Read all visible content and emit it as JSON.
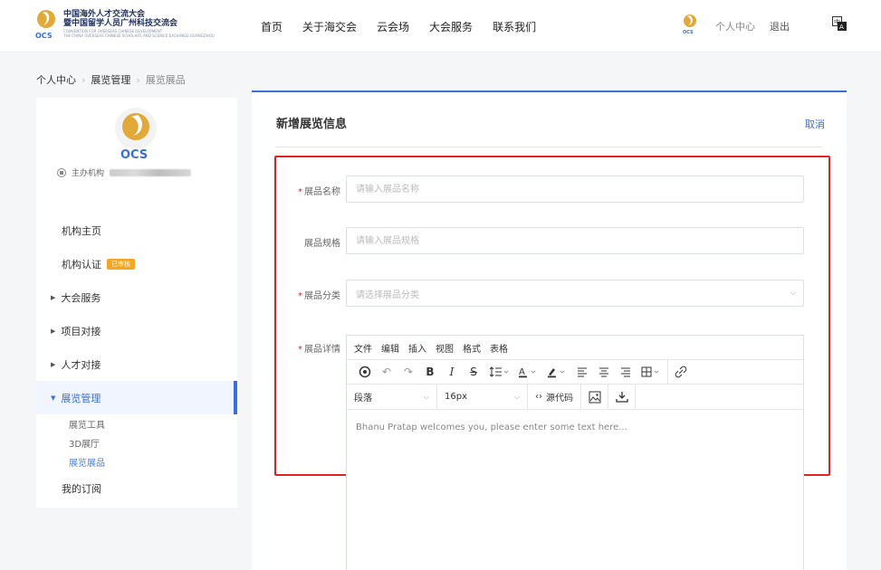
{
  "header": {
    "logo_line1": "中国海外人才交流大会",
    "logo_line2": "暨中国留学人员广州科技交流会",
    "logo_line3": "CONVENTION FOR OVERSEAS CHINESE DEVELOPMENT",
    "logo_line4": "THE CHINA OVERSEAS CHINESE SCHOLARS AND SCIENCE EXCHANGE GUANGZHOU",
    "nav": [
      "首页",
      "关于海交会",
      "云会场",
      "大会服务",
      "联系我们"
    ],
    "user_center": "个人中心",
    "logout": "退出"
  },
  "breadcrumb": [
    "个人中心",
    "展览管理",
    "展览展品"
  ],
  "sidebar": {
    "org_name": "主办机构",
    "menu": [
      {
        "label": "机构主页"
      },
      {
        "label": "机构认证",
        "badge": "已审核"
      },
      {
        "label": "大会服务"
      },
      {
        "label": "项目对接"
      },
      {
        "label": "人才对接"
      },
      {
        "label": "展览管理"
      },
      {
        "label": "我的订阅"
      }
    ],
    "submenu": [
      "展览工具",
      "3D展厅",
      "展览展品"
    ]
  },
  "main": {
    "title": "新增展览信息",
    "cancel": "取消",
    "fields": {
      "name_label": "展品名称",
      "name_placeholder": "请输入展品名称",
      "spec_label": "展品规格",
      "spec_placeholder": "请输入展品规格",
      "category_label": "展品分类",
      "category_placeholder": "请选择展品分类",
      "detail_label": "展品详情"
    },
    "editor": {
      "menubar": [
        "文件",
        "编辑",
        "插入",
        "视图",
        "格式",
        "表格"
      ],
      "block_format": "段落",
      "font_size": "16px",
      "source_code": "源代码",
      "content": "Bhanu Pratap welcomes you, please enter some text here..."
    }
  }
}
